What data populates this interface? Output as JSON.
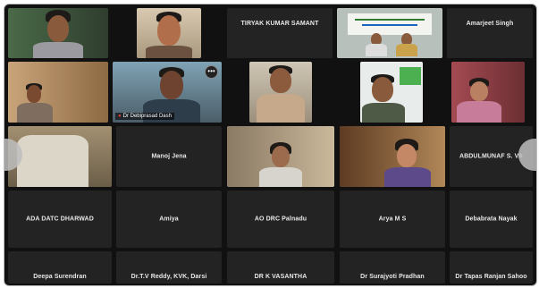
{
  "meeting": {
    "page_arrows": [
      "previous-page",
      "next-page"
    ],
    "row1": [
      {
        "name": "",
        "video": true
      },
      {
        "name": "",
        "video": true
      },
      {
        "name": "TIRYAK KUMAR SAMANT",
        "video": false
      },
      {
        "name": "",
        "video": true,
        "active": true
      },
      {
        "name": "Amarjeet Singh",
        "video": false
      }
    ],
    "row2": [
      {
        "name": "",
        "video": true
      },
      {
        "name": "Dr Debiprasad Dash",
        "video": true,
        "muted": true
      },
      {
        "name": "",
        "video": true
      },
      {
        "name": "",
        "video": true
      },
      {
        "name": "",
        "video": true
      }
    ],
    "row3": [
      {
        "name": "",
        "video": true
      },
      {
        "name": "Manoj Jena",
        "video": false
      },
      {
        "name": "",
        "video": true
      },
      {
        "name": "",
        "video": true
      },
      {
        "name": "ABDULMUNAF S. VA",
        "video": false
      }
    ],
    "row4": [
      {
        "name": "ADA DATC DHARWAD"
      },
      {
        "name": "Amiya"
      },
      {
        "name": "AO DRC Palnadu"
      },
      {
        "name": "Arya M S"
      },
      {
        "name": "Debabrata Nayak"
      }
    ],
    "row5": [
      {
        "name": "Deepa Surendran"
      },
      {
        "name": "Dr.T.V Reddy, KVK, Darsi"
      },
      {
        "name": "DR K VASANTHA"
      },
      {
        "name": "Dr Surajyoti Pradhan"
      },
      {
        "name": "Dr Tapas Ranjan Sahoo"
      }
    ],
    "more_icon": "•••",
    "mic_icon": "microphone-muted-icon"
  }
}
